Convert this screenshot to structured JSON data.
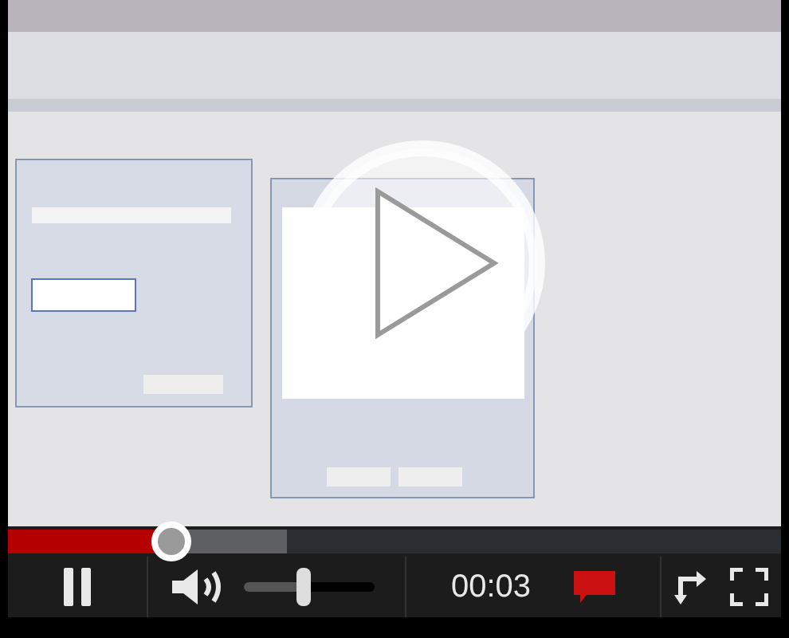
{
  "player": {
    "playing": true,
    "progress": {
      "level": 0.21
    },
    "buffered": {
      "level": 0.36
    },
    "volume": {
      "level": 0.45
    },
    "time": "00:03"
  }
}
